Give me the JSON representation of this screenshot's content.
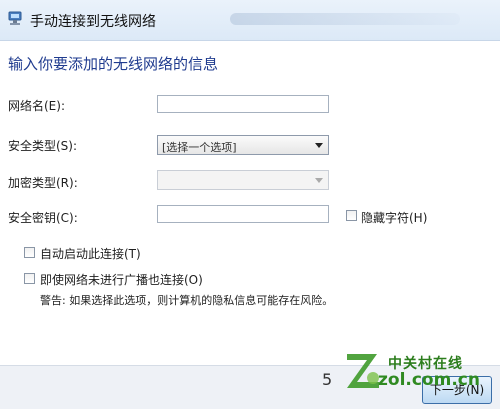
{
  "window": {
    "title": "手动连接到无线网络"
  },
  "heading": "输入你要添加的无线网络的信息",
  "fields": {
    "network_name_label": "网络名(E):",
    "security_type_label": "安全类型(S):",
    "security_type_value": "[选择一个选项]",
    "encryption_type_label": "加密类型(R):",
    "security_key_label": "安全密钥(C):",
    "hide_chars_label": "隐藏字符(H)"
  },
  "options": {
    "auto_start_label": "自动启动此连接(T)",
    "connect_hidden_label": "即使网络未进行广播也连接(O)",
    "warning": "警告: 如果选择此选项，则计算机的隐私信息可能存在风险。"
  },
  "footer": {
    "page_number": "5",
    "next_label": "下一步(N)"
  },
  "watermark": {
    "line1": "中关村在线",
    "line2": "zol.com.cn"
  },
  "colors": {
    "heading": "#1f3b8f",
    "accent": "#3b6ea8",
    "watermark": "#2f8a21"
  }
}
